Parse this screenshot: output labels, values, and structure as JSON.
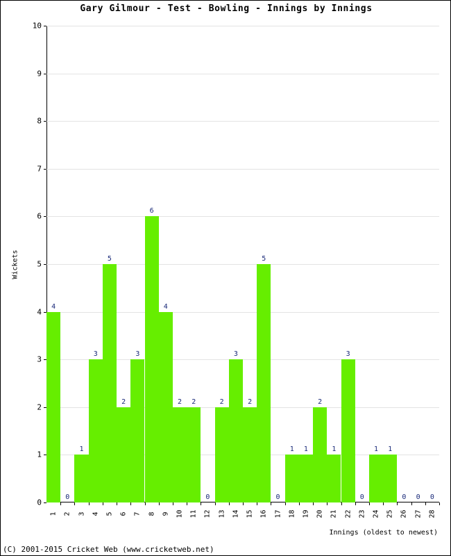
{
  "chart_data": {
    "type": "bar",
    "title": "Gary Gilmour - Test - Bowling - Innings by Innings",
    "xlabel": "Innings (oldest to newest)",
    "ylabel": "Wickets",
    "categories": [
      "1",
      "2",
      "3",
      "4",
      "5",
      "6",
      "7",
      "8",
      "9",
      "10",
      "11",
      "12",
      "13",
      "14",
      "15",
      "16",
      "17",
      "18",
      "19",
      "20",
      "21",
      "22",
      "23",
      "24",
      "25",
      "26",
      "27",
      "28"
    ],
    "values": [
      4,
      0,
      1,
      3,
      5,
      2,
      3,
      6,
      4,
      2,
      2,
      0,
      2,
      3,
      2,
      5,
      0,
      1,
      1,
      2,
      1,
      3,
      0,
      1,
      1,
      0,
      0,
      0
    ],
    "ylim": [
      0,
      10
    ],
    "yticks": [
      0,
      1,
      2,
      3,
      4,
      5,
      6,
      7,
      8,
      9,
      10
    ],
    "grid": true,
    "legend": false,
    "bar_color": "#66ee00",
    "value_label_color": "#182878",
    "gridline_color": "#e3e3e3"
  },
  "footer": {
    "copyright": "(C) 2001-2015 Cricket Web (www.cricketweb.net)"
  }
}
